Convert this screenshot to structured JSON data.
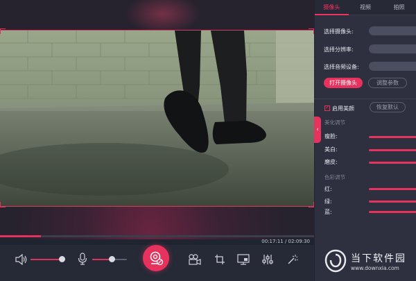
{
  "colors": {
    "accent": "#e8325e",
    "panel_bg": "#2e3040",
    "toolbar_bg": "#262a36"
  },
  "tabs": [
    {
      "label": "摄像头",
      "active": true
    },
    {
      "label": "视频",
      "active": false
    },
    {
      "label": "拍照",
      "active": false
    }
  ],
  "camera_settings": {
    "select_camera_label": "选择摄像头:",
    "select_resolution_label": "选择分辨率:",
    "select_audio_label": "选择音频设备:",
    "open_camera_button": "打开摄像头",
    "adjust_params_button": "调整参数"
  },
  "beauty": {
    "enable_label": "启用美颜",
    "enabled": true,
    "reset_button": "恢复默认",
    "section_title": "美化调节",
    "items": [
      {
        "label": "瘦脸:"
      },
      {
        "label": "美白:"
      },
      {
        "label": "磨皮:"
      }
    ]
  },
  "color_adjust": {
    "section_title": "色彩调节",
    "items": [
      {
        "label": "红:"
      },
      {
        "label": "绿:"
      },
      {
        "label": "蓝:"
      }
    ]
  },
  "playback": {
    "current_time": "00:17:11",
    "total_time": "02:09:30",
    "separator": " / ",
    "progress_fraction": 0.13
  },
  "volume": {
    "speaker_level": 0.89,
    "mic_level": 0.56
  },
  "toolbar_icons": [
    "speaker-icon",
    "microphone-icon",
    "record-camera-icon",
    "video-camera-icon",
    "crop-icon",
    "screen-record-icon",
    "equalizer-icon",
    "magic-wand-icon"
  ],
  "watermark": {
    "title": "当下软件园",
    "url": "www.downxia.com"
  }
}
